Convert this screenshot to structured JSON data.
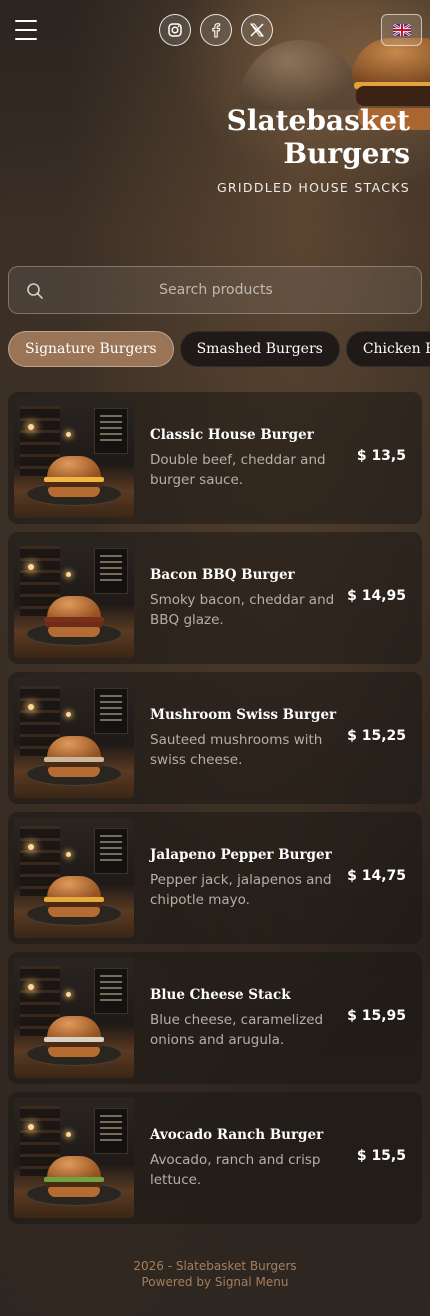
{
  "header": {
    "menu_icon": "hamburger-menu-icon",
    "socials": [
      {
        "name": "instagram",
        "icon": "instagram-icon"
      },
      {
        "name": "facebook",
        "icon": "facebook-icon"
      },
      {
        "name": "x",
        "icon": "x-icon"
      }
    ],
    "language_flag": "uk-flag-icon"
  },
  "brand": {
    "title": "Slatebasket Burgers",
    "tagline": "GRIDDLED HOUSE STACKS"
  },
  "search": {
    "placeholder": "Search products",
    "value": ""
  },
  "categories": [
    {
      "label": "Signature Burgers",
      "active": true
    },
    {
      "label": "Smashed Burgers",
      "active": false
    },
    {
      "label": "Chicken Burgers",
      "active": false
    }
  ],
  "products": [
    {
      "name": "Classic House Burger",
      "description": "Double beef, cheddar and burger sauce.",
      "price": "$ 13,5"
    },
    {
      "name": "Bacon BBQ Burger",
      "description": "Smoky bacon, cheddar and BBQ glaze.",
      "price": "$ 14,95"
    },
    {
      "name": "Mushroom Swiss Burger",
      "description": "Sauteed mushrooms with swiss cheese.",
      "price": "$ 15,25"
    },
    {
      "name": "Jalapeno Pepper Burger",
      "description": "Pepper jack, jalapenos and chipotle mayo.",
      "price": "$ 14,75"
    },
    {
      "name": "Blue Cheese Stack",
      "description": "Blue cheese, caramelized onions and arugula.",
      "price": "$ 15,95"
    },
    {
      "name": "Avocado Ranch Burger",
      "description": "Avocado, ranch and crisp lettuce.",
      "price": "$ 15,5"
    }
  ],
  "footer": {
    "copyright": "2026 - Slatebasket Burgers",
    "powered_by": "Powered by Signal Menu"
  },
  "colors": {
    "accent": "#9a7456",
    "footer_text": "#a57e5c",
    "card_bg": "#1c1714"
  }
}
